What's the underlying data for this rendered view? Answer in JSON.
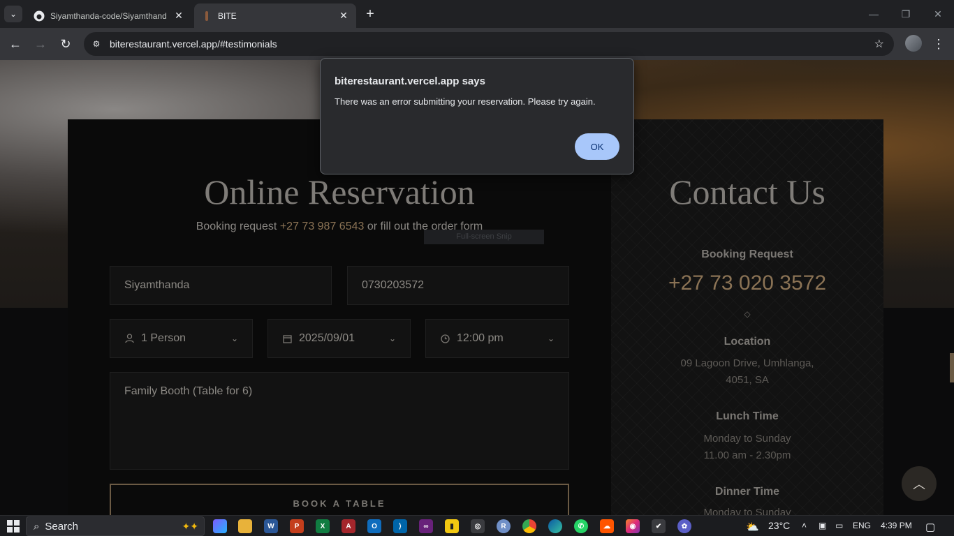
{
  "browser": {
    "tabs": [
      {
        "title": "Siyamthanda-code/Siyamthand",
        "active": false,
        "favicon": "github-icon"
      },
      {
        "title": "BITE",
        "active": true,
        "favicon": "site-favicon"
      }
    ],
    "url": "biterestaurant.vercel.app/#testimonials"
  },
  "dialog": {
    "title": "biterestaurant.vercel.app says",
    "message": "There was an error submitting your reservation. Please try again.",
    "ok_label": "OK"
  },
  "reservation": {
    "title": "Online Reservation",
    "subtitle_prefix": "Booking request",
    "subtitle_phone": "+27 73 987 6543",
    "subtitle_suffix": "or fill out the order form",
    "name_value": "Siyamthanda",
    "phone_value": "0730203572",
    "persons_value": "1 Person",
    "date_value": "2025/09/01",
    "time_value": "12:00 pm",
    "message_value": "Family Booth (Table for 6)",
    "book_label": "BOOK A TABLE",
    "snip_hint": "Full-screen Snip"
  },
  "contact": {
    "title": "Contact Us",
    "booking_label": "Booking Request",
    "booking_phone": "+27 73 020 3572",
    "location_label": "Location",
    "location_line1": "09 Lagoon Drive, Umhlanga,",
    "location_line2": "4051, SA",
    "lunch_label": "Lunch Time",
    "lunch_days": "Monday to Sunday",
    "lunch_hours": "11.00 am - 2.30pm",
    "dinner_label": "Dinner Time",
    "dinner_days": "Monday to Sunday"
  },
  "taskbar": {
    "search_label": "Search",
    "weather": "23°C",
    "language": "ENG",
    "time": "4:39 PM",
    "colors": {
      "accent": "#8b7355",
      "dialog_button": "#a8c7fa"
    }
  }
}
